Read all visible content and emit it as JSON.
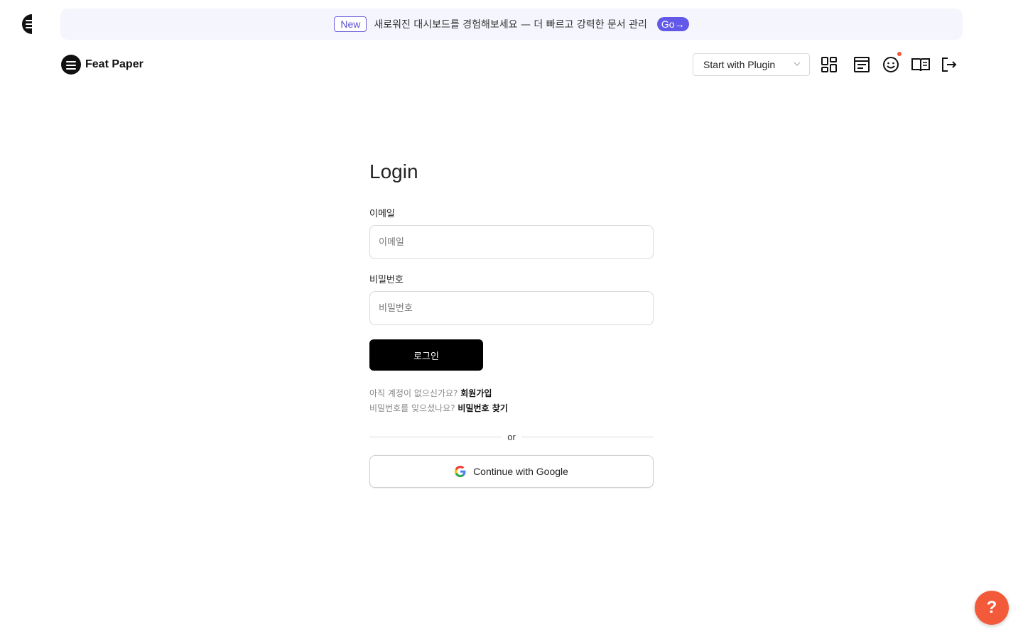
{
  "banner": {
    "badge": "New",
    "text": "새로워진 대시보드를 경험해보세요 — 더 빠르고 강력한 문서 관리",
    "go_label": "Go→"
  },
  "header": {
    "brand_name": "Feat Paper",
    "plugin_select": "Start with Plugin",
    "icons": [
      "dashboard-grid-icon",
      "document-window-icon",
      "smiley-icon",
      "open-book-icon",
      "logout-icon"
    ]
  },
  "login": {
    "title": "Login",
    "email_label": "이메일",
    "email_placeholder": "이메일",
    "email_value": "",
    "password_label": "비밀번호",
    "password_placeholder": "비밀번호",
    "password_value": "",
    "submit_label": "로그인",
    "signup_prompt": "아직 계정이 없으신가요?",
    "signup_link": "회원가입",
    "forgot_prompt": "비밀번호를 잊으셨나요?",
    "forgot_link": "비밀번호 찾기",
    "divider_text": "or",
    "google_label": "Continue with Google"
  },
  "help": {
    "label": "?"
  },
  "colors": {
    "accent": "#6259e8",
    "primary_button": "#000000",
    "help_fab": "#f25a3a",
    "notification_dot": "#f05a3a"
  }
}
